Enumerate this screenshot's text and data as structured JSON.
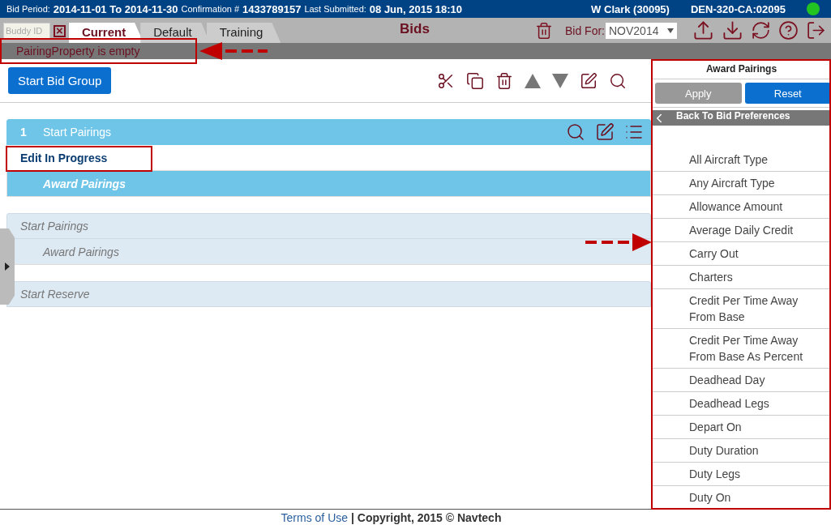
{
  "header": {
    "bid_period_label": "Bid Period:",
    "bid_period": "2014-11-01 To 2014-11-30",
    "confirmation_label": "Confirmation #",
    "confirmation": "1433789157",
    "last_submitted_label": "Last Submitted:",
    "last_submitted": "08 Jun, 2015 18:10",
    "user": "W Clark (30095)",
    "base": "DEN-320-CA:02095"
  },
  "toolbar": {
    "buddy_placeholder": "Buddy ID",
    "clear": "×",
    "tabs": [
      {
        "label": "Current",
        "selected": true
      },
      {
        "label": "Default",
        "selected": false
      },
      {
        "label": "Training",
        "selected": false
      }
    ],
    "title": "Bids",
    "bid_for_label": "Bid For:",
    "bid_for": "NOV2014"
  },
  "message": "PairingProperty is empty",
  "main": {
    "start_button": "Start Bid Group",
    "groups": [
      {
        "kind": "active",
        "number": "1",
        "title": "Start Pairings",
        "rows": [
          {
            "kind": "edit",
            "label": "Edit In Progress"
          },
          {
            "kind": "item",
            "label": "Award Pairings"
          }
        ]
      },
      {
        "kind": "inactive",
        "title": "Start Pairings",
        "rows": [
          {
            "kind": "item",
            "label": "Award Pairings"
          }
        ]
      },
      {
        "kind": "inactive",
        "title": "Start Reserve"
      }
    ]
  },
  "panel": {
    "title": "Award Pairings",
    "apply": {
      "label": "Apply",
      "disabled": true
    },
    "reset": {
      "label": "Reset",
      "disabled": false
    },
    "back": "Back To Bid Preferences",
    "items": [
      "All Aircraft Type",
      "Any Aircraft Type",
      "Allowance Amount",
      "Average Daily Credit",
      "Carry Out",
      "Charters",
      "Credit Per Time Away From Base",
      "Credit Per Time Away From Base As Percent",
      "Deadhead Day",
      "Deadhead Legs",
      "Depart On",
      "Duty Duration",
      "Duty Legs",
      "Duty On"
    ]
  },
  "footer": {
    "link": "Terms of Use",
    "text": "| Copyright, 2015 © Navtech"
  }
}
